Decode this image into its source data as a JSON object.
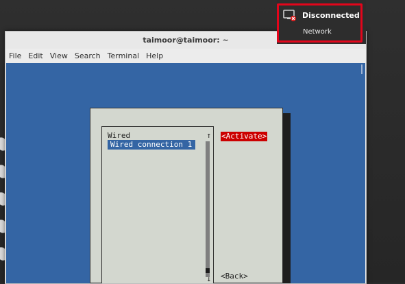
{
  "window": {
    "title": "taimoor@taimoor: ~",
    "menu": [
      "File",
      "Edit",
      "View",
      "Search",
      "Terminal",
      "Help"
    ]
  },
  "nmtui": {
    "list_header": "Wired",
    "list_items": [
      "Wired connection 1"
    ],
    "selected_item": "Wired connection 1",
    "scroll_up_arrow": "↑",
    "scroll_down_arrow": "↓",
    "activate_button": "<Activate>",
    "back_button": "<Back>"
  },
  "network_popup": {
    "status": "Disconnected",
    "label": "Network",
    "icon": "network-disconnected-icon"
  },
  "colors": {
    "terminal_bg": "#3465a4",
    "dialog_bg": "#d3d7cf",
    "selection": "#3465a4",
    "activate_highlight": "#cc0000",
    "annotation_border": "#e3051b"
  }
}
